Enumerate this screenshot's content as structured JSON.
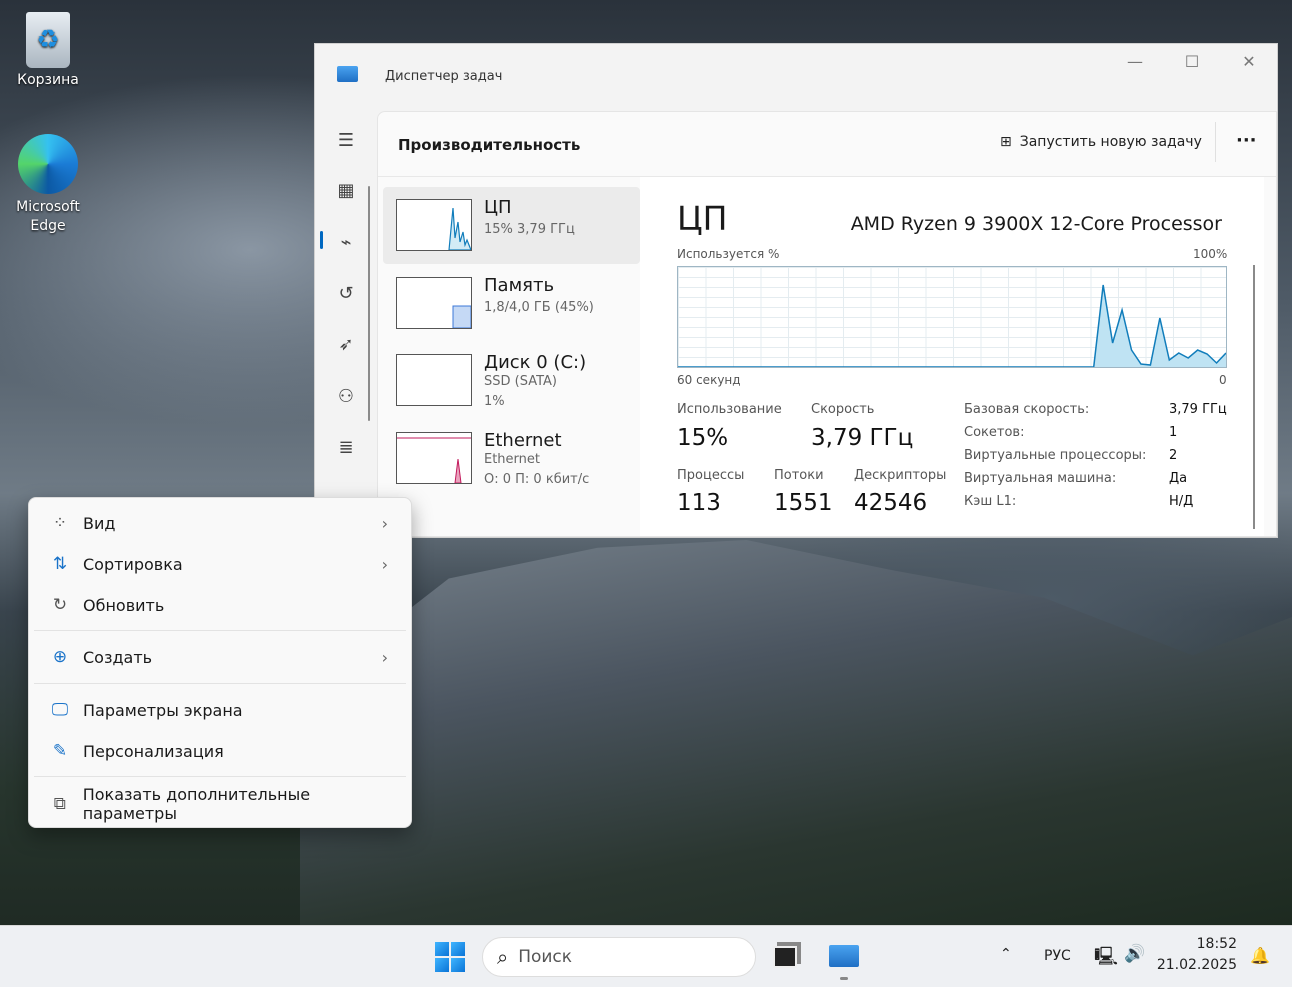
{
  "desktop": {
    "icons": [
      {
        "label": "Корзина",
        "icon": "recycle-bin-icon"
      },
      {
        "label": "Microsoft Edge",
        "icon": "edge-icon"
      }
    ]
  },
  "window": {
    "title": "Диспетчер задач",
    "header": "Производительность",
    "run_task": "Запустить новую задачу",
    "more": "···",
    "nav_icons": [
      "hamburger-icon",
      "processes-icon",
      "performance-icon",
      "app-history-icon",
      "startup-icon",
      "users-icon",
      "details-icon"
    ],
    "selected_nav": "performance-icon",
    "resources": [
      {
        "name": "ЦП",
        "sub1": "15% 3,79 ГГц",
        "sub2": "",
        "color": "#117dbb"
      },
      {
        "name": "Память",
        "sub1": "1,8/4,0 ГБ (45%)",
        "sub2": "",
        "color": "#3c78d8"
      },
      {
        "name": "Диск 0 (C:)",
        "sub1": "SSD (SATA)",
        "sub2": "1%",
        "color": "#4da060"
      },
      {
        "name": "Ethernet",
        "sub1": "Ethernet",
        "sub2": "О: 0 П: 0 кбит/с",
        "color": "#c2185b"
      }
    ],
    "detail": {
      "title": "ЦП",
      "processor": "AMD Ryzen 9 3900X 12-Core Processor",
      "usage_label": "Используется %",
      "max_label": "100%",
      "time_label": "60 секунд",
      "min_label": "0",
      "stats": {
        "usage_label": "Использование",
        "usage": "15%",
        "speed_label": "Скорость",
        "speed": "3,79 ГГц",
        "proc_label": "Процессы",
        "proc": "113",
        "threads_label": "Потоки",
        "threads": "1551",
        "handles_label": "Дескрипторы",
        "handles": "42546"
      },
      "specs": [
        {
          "k": "Базовая скорость:",
          "v": "3,79 ГГц"
        },
        {
          "k": "Сокетов:",
          "v": "1"
        },
        {
          "k": "Виртуальные процессоры:",
          "v": "2"
        },
        {
          "k": "Виртуальная машина:",
          "v": "Да"
        },
        {
          "k": "Кэш L1:",
          "v": "Н/Д"
        }
      ]
    },
    "cpu_history_percent": [
      0,
      0,
      0,
      0,
      0,
      0,
      0,
      0,
      0,
      0,
      0,
      0,
      0,
      0,
      0,
      0,
      0,
      0,
      0,
      0,
      0,
      0,
      0,
      0,
      0,
      0,
      0,
      0,
      0,
      0,
      0,
      0,
      0,
      0,
      0,
      0,
      0,
      0,
      0,
      0,
      0,
      0,
      0,
      0,
      0,
      82,
      24,
      57,
      17,
      3,
      2,
      49,
      7,
      14,
      9,
      17,
      13,
      4,
      14
    ]
  },
  "context_menu": {
    "items": [
      {
        "label": "Вид",
        "icon": "grid-icon",
        "submenu": true
      },
      {
        "label": "Сортировка",
        "icon": "sort-icon",
        "submenu": true
      },
      {
        "label": "Обновить",
        "icon": "refresh-icon",
        "submenu": false
      },
      {
        "label": "Создать",
        "icon": "plus-circle-icon",
        "submenu": true
      },
      {
        "label": "Параметры экрана",
        "icon": "display-settings-icon",
        "submenu": false
      },
      {
        "label": "Персонализация",
        "icon": "brush-icon",
        "submenu": false
      },
      {
        "label": "Показать дополнительные параметры",
        "icon": "open-external-icon",
        "submenu": false
      }
    ]
  },
  "taskbar": {
    "search_placeholder": "Поиск",
    "lang": "РУС",
    "time": "18:52",
    "date": "21.02.2025"
  }
}
